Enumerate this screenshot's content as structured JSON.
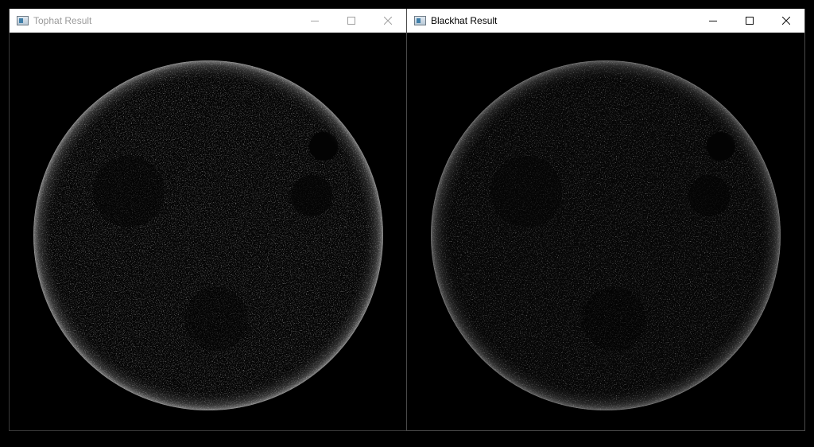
{
  "windows": [
    {
      "id": "tophat",
      "title": "Tophat Result",
      "state": "inactive",
      "image": "moon-tophat-morphology-image"
    },
    {
      "id": "blackhat",
      "title": "Blackhat Result",
      "state": "active",
      "image": "moon-blackhat-morphology-image"
    }
  ],
  "controls": {
    "minimize": "minimize-icon",
    "maximize": "maximize-icon",
    "close": "close-icon"
  },
  "colors": {
    "background": "#000000",
    "titlebar": "#ffffff",
    "inactive_title": "#9a9a9a",
    "active_title": "#000000"
  }
}
